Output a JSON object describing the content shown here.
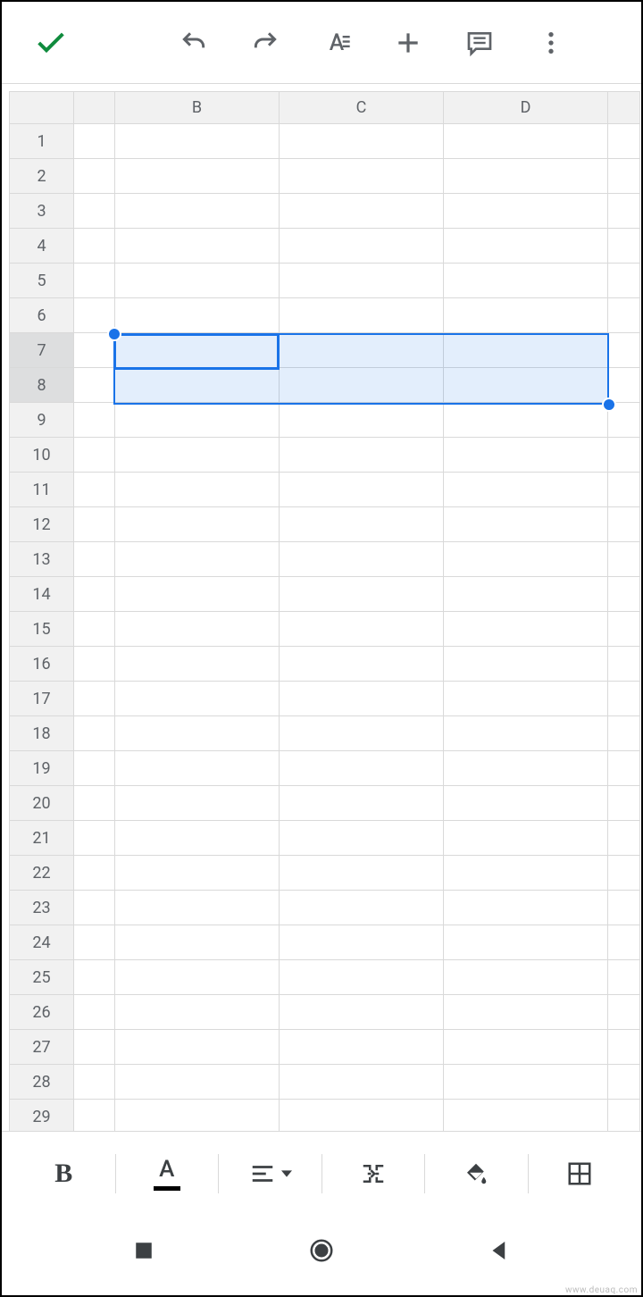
{
  "toolbar": {
    "confirm": "Accept",
    "undo": "Undo",
    "redo": "Redo",
    "format": "Text format",
    "insert": "Insert",
    "comment": "Comment",
    "more": "More options"
  },
  "columns": [
    "B",
    "C",
    "D"
  ],
  "rows": [
    "1",
    "2",
    "3",
    "4",
    "5",
    "6",
    "7",
    "8",
    "9",
    "10",
    "11",
    "12",
    "13",
    "14",
    "15",
    "16",
    "17",
    "18",
    "19",
    "20",
    "21",
    "22",
    "23",
    "24",
    "25",
    "26",
    "27",
    "28",
    "29"
  ],
  "selection": {
    "active_cell": "B7",
    "range": "B7:D8",
    "highlighted_rows": [
      "7",
      "8"
    ]
  },
  "format_bar": {
    "bold": "B",
    "text_color": "A",
    "align": "Align",
    "merge": "Merge cells",
    "fill": "Fill color",
    "borders": "Borders"
  },
  "nav": {
    "recents": "Recents",
    "home": "Home",
    "back": "Back"
  },
  "watermark": "www.deuaq.com"
}
